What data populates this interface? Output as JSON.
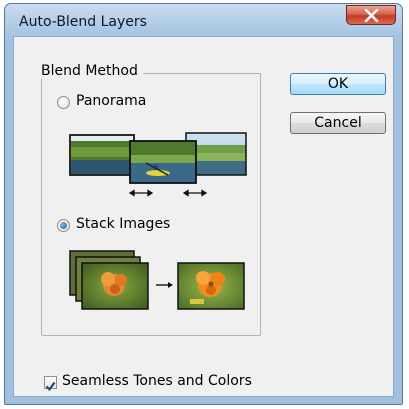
{
  "window": {
    "title": "Auto-Blend Layers",
    "close_icon": "close-icon"
  },
  "group": {
    "title": "Blend Method",
    "options": [
      {
        "label": "Panorama",
        "selected": false
      },
      {
        "label": "Stack Images",
        "selected": true
      }
    ]
  },
  "buttons": {
    "ok_label": "OK",
    "cancel_label": "Cancel"
  },
  "options": {
    "seamless_label": "Seamless Tones and Colors",
    "seamless_checked": true
  },
  "colors": {
    "title_bar": "#a9c7e3",
    "close_button": "#c23b26",
    "dialog_bg": "#f0f0f0",
    "radio_selected": "#1b5fa6",
    "default_button": "#a7d9f5"
  }
}
